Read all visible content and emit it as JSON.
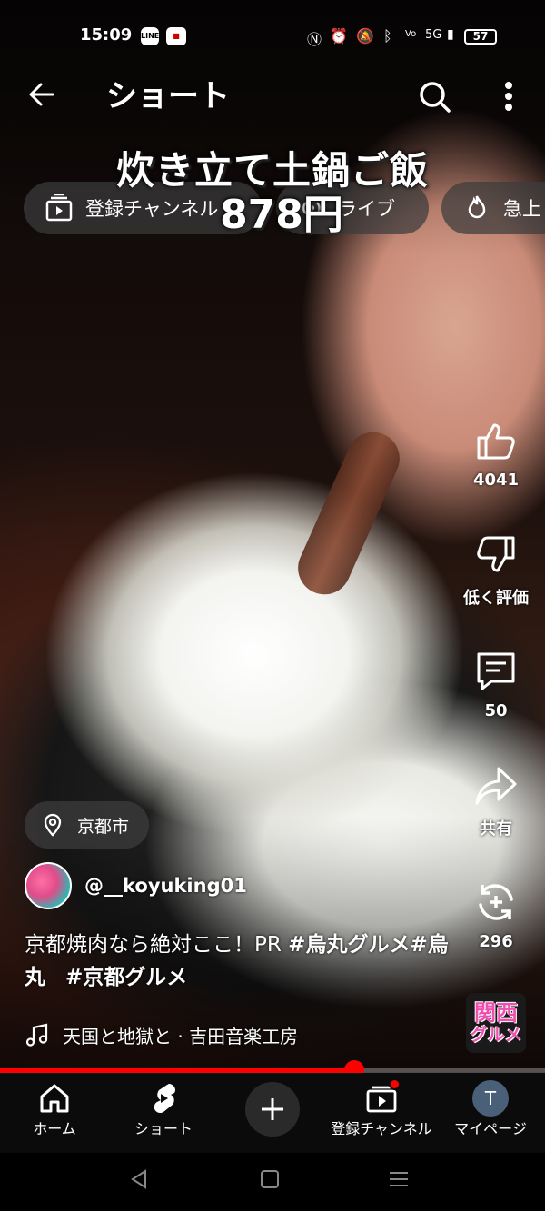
{
  "status_bar": {
    "time": "15:09",
    "app_icon_1": "LINE",
    "app_icon_2": "app",
    "network": "5G",
    "battery": "57"
  },
  "header": {
    "back_icon": "arrow-left-icon",
    "title": "ショート",
    "search_icon": "search-icon",
    "more_icon": "more-vertical-icon"
  },
  "video_overlay": {
    "caption_line1": "炊き立て土鍋ご飯",
    "caption_line2": "878円"
  },
  "filter_chips": [
    {
      "label": "登録チャンネル",
      "icon": "subscriptions-icon"
    },
    {
      "label": "ライブ",
      "icon": "live-icon"
    },
    {
      "label": "急上",
      "icon": "trending-icon"
    }
  ],
  "actions": {
    "like_count": "4041",
    "dislike_label": "低く評価",
    "comment_count": "50",
    "share_label": "共有",
    "remix_count": "296"
  },
  "location": {
    "label": "京都市"
  },
  "channel": {
    "handle": "@__koyuking01"
  },
  "description": {
    "text": "京都焼肉なら絶対ここ！PR ",
    "tag1": "#烏丸グルメ",
    "tag2": "#烏丸",
    "tag3": "#京都グルメ"
  },
  "music": {
    "label": "天国と地獄と · 吉田音楽工房"
  },
  "badge": {
    "line1": "関西",
    "line2": "グルメ"
  },
  "progress": {
    "fraction": 0.65
  },
  "bottom_nav": {
    "home": "ホーム",
    "shorts": "ショート",
    "subscriptions": "登録チャンネル",
    "mypage": "マイページ",
    "avatar_letter": "T"
  },
  "colors": {
    "accent": "#ff0000",
    "nav_bg": "#0b0b0b"
  }
}
